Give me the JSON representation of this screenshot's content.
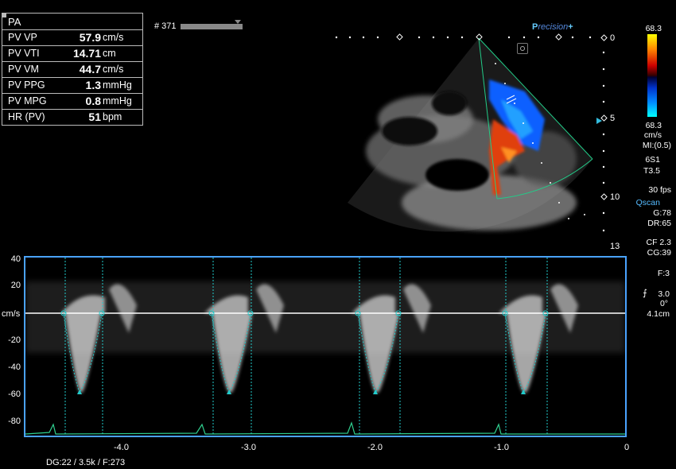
{
  "measurements": {
    "header": "PA",
    "rows": [
      {
        "label": "PV VP",
        "value": "57.9",
        "unit": "cm/s"
      },
      {
        "label": "PV VTI",
        "value": "14.71",
        "unit": "cm"
      },
      {
        "label": "PV VM",
        "value": "44.7",
        "unit": "cm/s"
      },
      {
        "label": "PV PPG",
        "value": "1.3",
        "unit": "mmHg"
      },
      {
        "label": "PV MPG",
        "value": "0.8",
        "unit": "mmHg"
      },
      {
        "label": "HR (PV)",
        "value": "51",
        "unit": "bpm"
      }
    ]
  },
  "frame": {
    "label": "# 371"
  },
  "brand": {
    "prefix": "P",
    "name": "recision",
    "suffix": "+"
  },
  "depth_scale": [
    "0",
    "5",
    "10",
    "13"
  ],
  "color_scale": {
    "top": "68.3",
    "bottom": "68.3",
    "unit": "cm/s"
  },
  "params": {
    "mi": "MI:(0.5)",
    "probe": "6S1",
    "preset": "T3.5",
    "fps": "30 fps",
    "qscan": "Qscan",
    "gain": "G:78",
    "dr": "DR:65",
    "cf": "CF 2.3",
    "cg": "CG:39",
    "f": "F:3",
    "angle_val": "3.0",
    "angle_deg": "0°",
    "gate_depth": "4.1cm"
  },
  "doppler": {
    "y_ticks": [
      "40",
      "20",
      "cm/s",
      "-20",
      "-40",
      "-60",
      "-80"
    ],
    "x_ticks": [
      "-4.0",
      "-3.0",
      "-2.0",
      "-1.0",
      "0"
    ],
    "y_unit": "cm/s"
  },
  "bottom_info": {
    "dg": "DG:22",
    "prf": "/ 3.5k",
    "f": "/ F:273"
  }
}
